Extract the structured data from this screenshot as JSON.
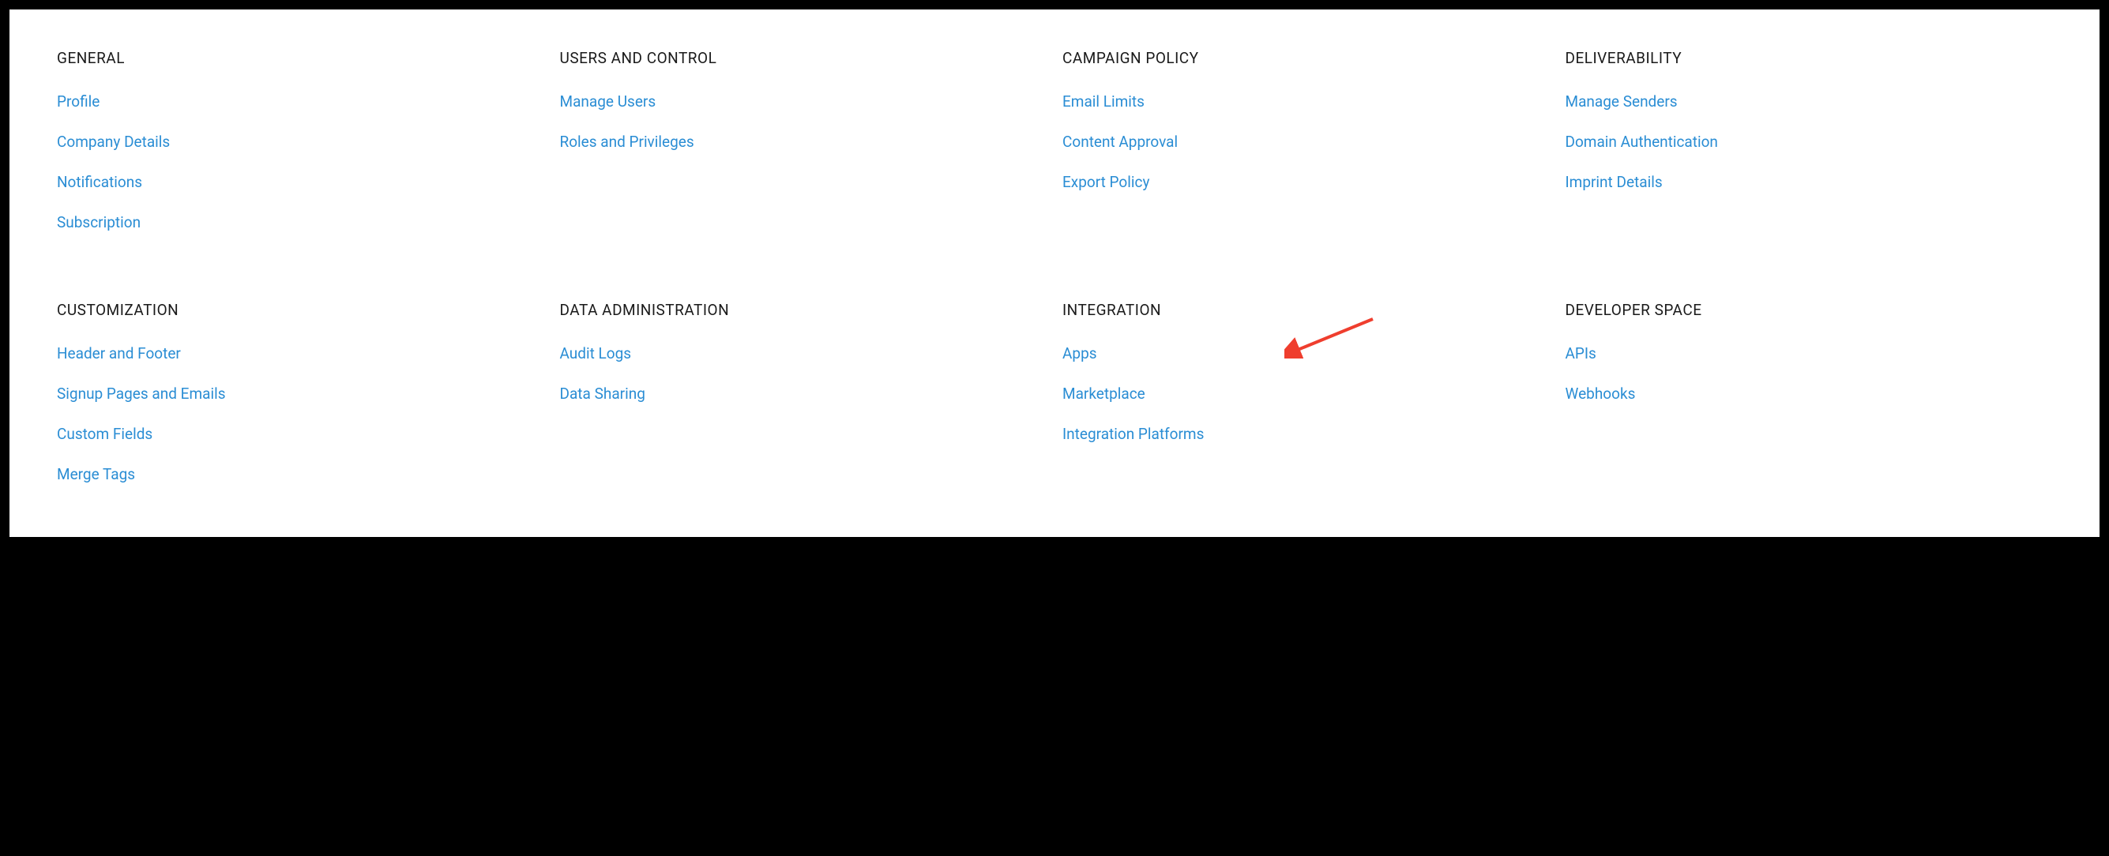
{
  "sections": [
    {
      "title": "GENERAL",
      "links": [
        "Profile",
        "Company Details",
        "Notifications",
        "Subscription"
      ]
    },
    {
      "title": "USERS AND CONTROL",
      "links": [
        "Manage Users",
        "Roles and Privileges"
      ]
    },
    {
      "title": "CAMPAIGN POLICY",
      "links": [
        "Email Limits",
        "Content Approval",
        "Export Policy"
      ]
    },
    {
      "title": "DELIVERABILITY",
      "links": [
        "Manage Senders",
        "Domain Authentication",
        "Imprint Details"
      ]
    },
    {
      "title": "CUSTOMIZATION",
      "links": [
        "Header and Footer",
        "Signup Pages and Emails",
        "Custom Fields",
        "Merge Tags"
      ]
    },
    {
      "title": "DATA ADMINISTRATION",
      "links": [
        "Audit Logs",
        "Data Sharing"
      ]
    },
    {
      "title": "INTEGRATION",
      "links": [
        "Apps",
        "Marketplace",
        "Integration Platforms"
      ]
    },
    {
      "title": "DEVELOPER SPACE",
      "links": [
        "APIs",
        "Webhooks"
      ]
    }
  ]
}
